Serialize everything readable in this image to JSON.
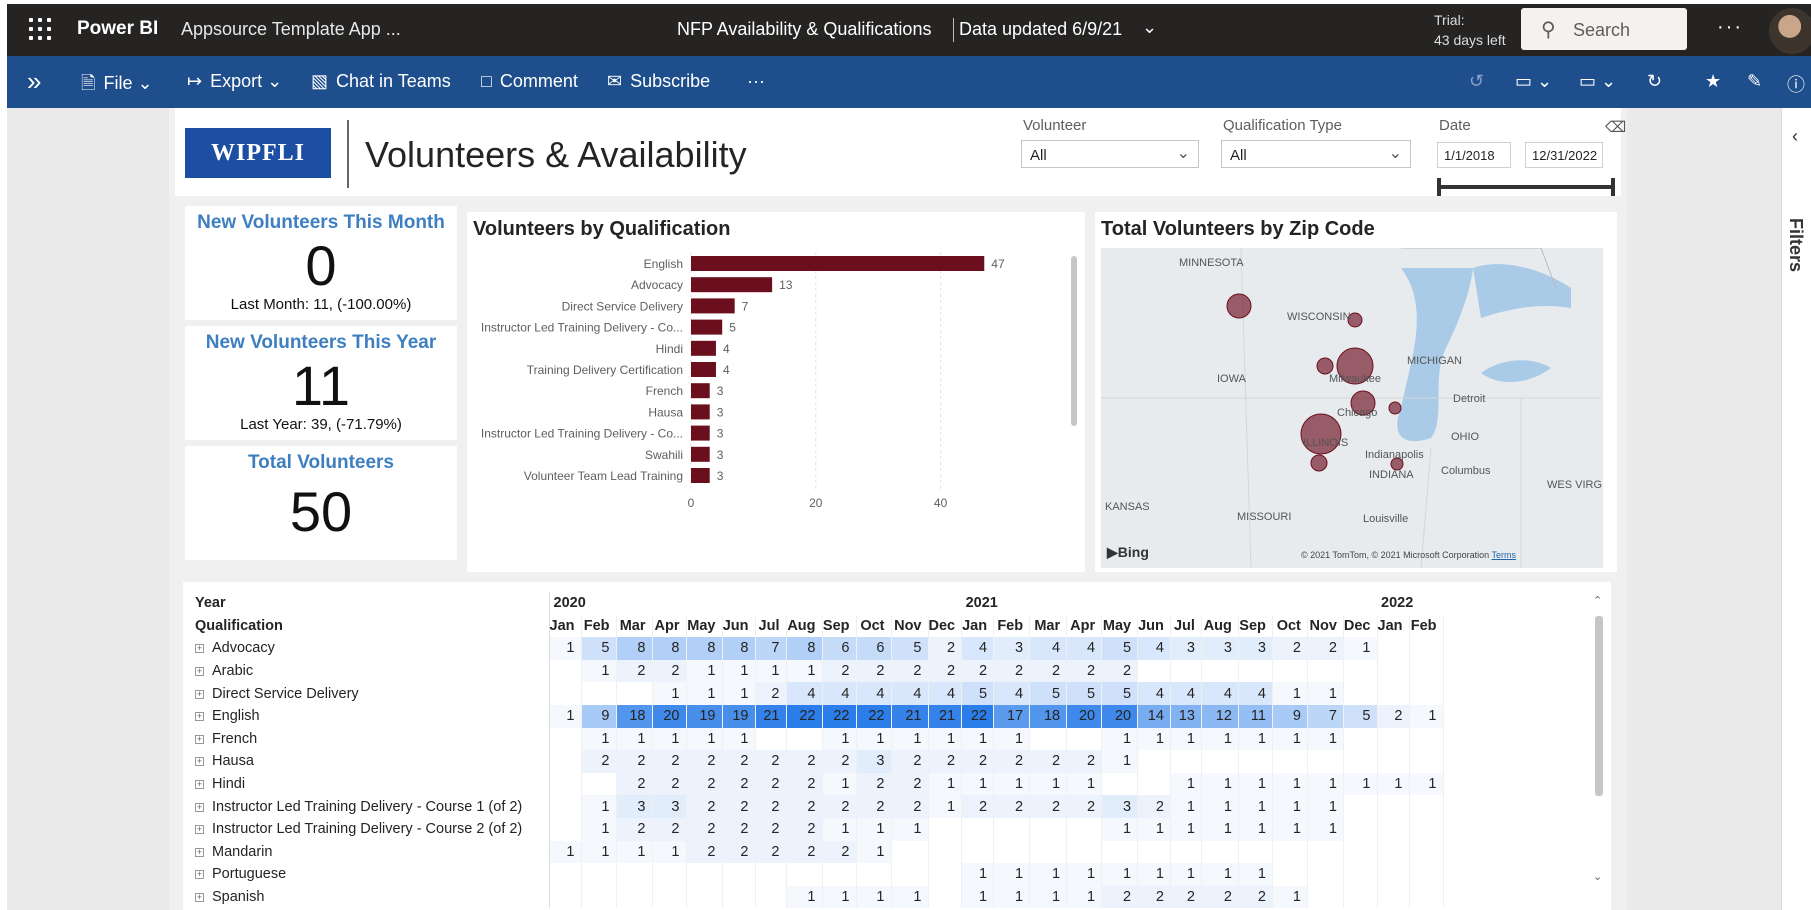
{
  "topbar": {
    "brand": "Power BI",
    "workspace": "Appsource Template App ...",
    "report_name": "NFP Availability & Qualifications",
    "data_updated": "Data updated 6/9/21",
    "trial_line1": "Trial:",
    "trial_line2": "43 days left",
    "search_placeholder": "Search"
  },
  "actions": {
    "file": "File",
    "export": "Export",
    "chat": "Chat in Teams",
    "comment": "Comment",
    "subscribe": "Subscribe"
  },
  "pane": {
    "filters": "Filters"
  },
  "header": {
    "logo": "WIPFLI",
    "title": "Volunteers & Availability",
    "volunteer_label": "Volunteer",
    "volunteer_value": "All",
    "qualtype_label": "Qualification Type",
    "qualtype_value": "All",
    "date_label": "Date",
    "date_start": "1/1/2018",
    "date_end": "12/31/2022"
  },
  "cards": {
    "month_title": "New Volunteers This Month",
    "month_value": "0",
    "month_sub": "Last Month: 11, (-100.00%)",
    "year_title": "New Volunteers This Year",
    "year_value": "11",
    "year_sub": "Last Year: 39, (-71.79%)",
    "total_title": "Total Volunteers",
    "total_value": "50"
  },
  "bar_title": "Volunteers by Qualification",
  "map_title": "Total Volunteers by Zip Code",
  "map": {
    "labels": [
      "MINNESOTA",
      "WISCONSIN",
      "MICHIGAN",
      "IOWA",
      "Milwaukee",
      "Detroit",
      "Chicago",
      "OHIO",
      "ILLINOIS",
      "Indianapolis",
      "Columbus",
      "INDIANA",
      "MISSOURI",
      "KANSAS",
      "WES VIRGIN",
      "Louisville"
    ],
    "credit": "© 2021 TomTom, © 2021 Microsoft Corporation",
    "terms": "Terms",
    "bing": "Bing"
  },
  "chart_data": {
    "type": "bar",
    "title": "Volunteers by Qualification",
    "categories": [
      "English",
      "Advocacy",
      "Direct Service Delivery",
      "Instructor Led Training Delivery - Co...",
      "Hindi",
      "Training Delivery Certification",
      "French",
      "Hausa",
      "Instructor Led Training Delivery - Co...",
      "Swahili",
      "Volunteer Team Lead Training"
    ],
    "values": [
      47,
      13,
      7,
      5,
      4,
      4,
      3,
      3,
      3,
      3,
      3
    ],
    "xlim": [
      0,
      50
    ],
    "xticks": [
      0,
      20,
      40
    ],
    "color": "#6b0f1e",
    "grid": true
  },
  "matrix": {
    "h_year": "Year",
    "h_qual": "Qualification",
    "years": [
      {
        "label": "2020",
        "span": 12
      },
      {
        "label": "2021",
        "span": 12
      },
      {
        "label": "2022",
        "span": 2
      }
    ],
    "months": [
      "Jan",
      "Feb",
      "Mar",
      "Apr",
      "May",
      "Jun",
      "Jul",
      "Aug",
      "Sep",
      "Oct",
      "Nov",
      "Dec",
      "Jan",
      "Feb",
      "Mar",
      "Apr",
      "May",
      "Jun",
      "Jul",
      "Aug",
      "Sep",
      "Oct",
      "Nov",
      "Dec",
      "Jan",
      "Feb"
    ],
    "rows": [
      {
        "name": "Advocacy",
        "values": [
          1,
          5,
          8,
          8,
          8,
          8,
          7,
          8,
          6,
          6,
          5,
          2,
          4,
          3,
          4,
          4,
          5,
          4,
          3,
          3,
          3,
          2,
          2,
          1,
          null,
          null
        ]
      },
      {
        "name": "Arabic",
        "values": [
          null,
          1,
          2,
          2,
          1,
          1,
          1,
          1,
          2,
          2,
          2,
          2,
          2,
          2,
          2,
          2,
          2,
          null,
          null,
          null,
          null,
          null,
          null,
          null,
          null,
          null
        ]
      },
      {
        "name": "Direct Service Delivery",
        "values": [
          null,
          null,
          null,
          1,
          1,
          1,
          2,
          4,
          4,
          4,
          4,
          4,
          5,
          4,
          5,
          5,
          5,
          4,
          4,
          4,
          4,
          1,
          1,
          null,
          null,
          null
        ]
      },
      {
        "name": "English",
        "values": [
          1,
          9,
          18,
          20,
          19,
          19,
          21,
          22,
          22,
          22,
          21,
          21,
          22,
          17,
          18,
          20,
          20,
          14,
          13,
          12,
          11,
          9,
          7,
          5,
          2,
          1
        ]
      },
      {
        "name": "French",
        "values": [
          null,
          1,
          1,
          1,
          1,
          1,
          null,
          null,
          1,
          1,
          1,
          1,
          1,
          1,
          null,
          null,
          1,
          1,
          1,
          1,
          1,
          1,
          1,
          null,
          null,
          null
        ]
      },
      {
        "name": "Hausa",
        "values": [
          null,
          2,
          2,
          2,
          2,
          2,
          2,
          2,
          2,
          3,
          2,
          2,
          2,
          2,
          2,
          2,
          1,
          null,
          null,
          null,
          null,
          null,
          null,
          null,
          null,
          null
        ]
      },
      {
        "name": "Hindi",
        "values": [
          null,
          null,
          2,
          2,
          2,
          2,
          2,
          2,
          1,
          2,
          2,
          1,
          1,
          1,
          1,
          1,
          null,
          null,
          1,
          1,
          1,
          1,
          1,
          1,
          1,
          1
        ]
      },
      {
        "name": "Instructor Led Training Delivery - Course 1 (of 2)",
        "values": [
          null,
          1,
          3,
          3,
          2,
          2,
          2,
          2,
          2,
          2,
          2,
          1,
          2,
          2,
          2,
          2,
          3,
          2,
          1,
          1,
          1,
          1,
          1,
          null,
          null,
          null
        ]
      },
      {
        "name": "Instructor Led Training Delivery - Course 2 (of 2)",
        "values": [
          null,
          1,
          2,
          2,
          2,
          2,
          2,
          2,
          1,
          1,
          1,
          null,
          null,
          null,
          null,
          null,
          1,
          1,
          1,
          1,
          1,
          1,
          1,
          null,
          null,
          null
        ]
      },
      {
        "name": "Mandarin",
        "values": [
          1,
          1,
          1,
          1,
          2,
          2,
          2,
          2,
          2,
          1,
          null,
          null,
          null,
          null,
          null,
          null,
          null,
          null,
          null,
          null,
          null,
          null,
          null,
          null,
          null,
          null
        ]
      },
      {
        "name": "Portuguese",
        "values": [
          null,
          null,
          null,
          null,
          null,
          null,
          null,
          null,
          null,
          null,
          null,
          null,
          1,
          1,
          1,
          1,
          1,
          1,
          1,
          1,
          1,
          null,
          null,
          null,
          null,
          null
        ]
      },
      {
        "name": "Spanish",
        "values": [
          null,
          null,
          null,
          null,
          null,
          null,
          null,
          1,
          1,
          1,
          1,
          null,
          1,
          1,
          1,
          1,
          2,
          2,
          2,
          2,
          2,
          1,
          null,
          null,
          null,
          null
        ]
      }
    ]
  },
  "colors": {
    "topbar": "#252423",
    "actionbar": "#1f4e8c",
    "accent": "#3e7fc1",
    "bar": "#6b0f1e",
    "heat_max": "#2b7de9"
  }
}
